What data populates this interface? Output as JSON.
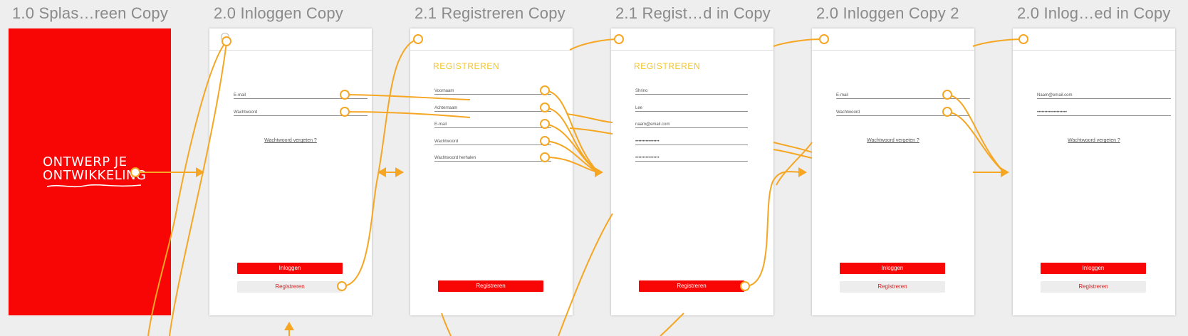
{
  "colors": {
    "connector": "#f5a623",
    "brand_red": "#f80505",
    "section_yellow": "#f5c518",
    "canvas_bg": "#eeeeee"
  },
  "artboards": [
    {
      "title": "1.0 Splas…reen Copy",
      "logo": {
        "line1": "ONTWERP JE",
        "line2": "ONTWIKKELING"
      }
    },
    {
      "title": "2.0 Inloggen Copy",
      "fields": [
        "E-mail",
        "Wachtwoord"
      ],
      "link": "Wachtwoord vergeten ?",
      "primary_button": "Inloggen",
      "secondary_button": "Registreren"
    },
    {
      "title": "2.1 Registreren Copy",
      "heading": "REGISTREREN",
      "fields": [
        "Voornaam",
        "Achternaam",
        "E-mail",
        "Wachtwoord",
        "Wachtwoord herhalen"
      ],
      "primary_button": "Registreren"
    },
    {
      "title": "2.1 Regist…d in Copy",
      "heading": "REGISTREREN",
      "fields": [
        "Shrino",
        "Lee",
        "naam@email.com",
        "••••••••••••••••",
        "••••••••••••••••"
      ],
      "primary_button": "Registreren"
    },
    {
      "title": "2.0 Inloggen Copy 2",
      "fields": [
        "E-mail",
        "Wachtwoord"
      ],
      "link": "Wachtwoord vergeten ?",
      "primary_button": "Inloggen",
      "secondary_button": "Registreren"
    },
    {
      "title": "2.0 Inlog…ed in Copy",
      "fields": [
        "Naam@email.com",
        "••••••••••••••••••••"
      ],
      "link": "Wachtwoord vergeten ?",
      "primary_button": "Inloggen",
      "secondary_button": "Registreren"
    }
  ]
}
